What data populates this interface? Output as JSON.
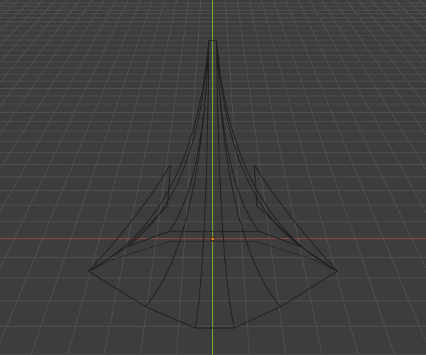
{
  "viewport": {
    "background_color": "#3d3d3d",
    "grid_color": "#545454",
    "x_axis_color": "#c8504f",
    "y_axis_color": "#7fb52a",
    "mesh_wire_color": "#1e1e1e",
    "origin_color": "#ff8a1c"
  }
}
